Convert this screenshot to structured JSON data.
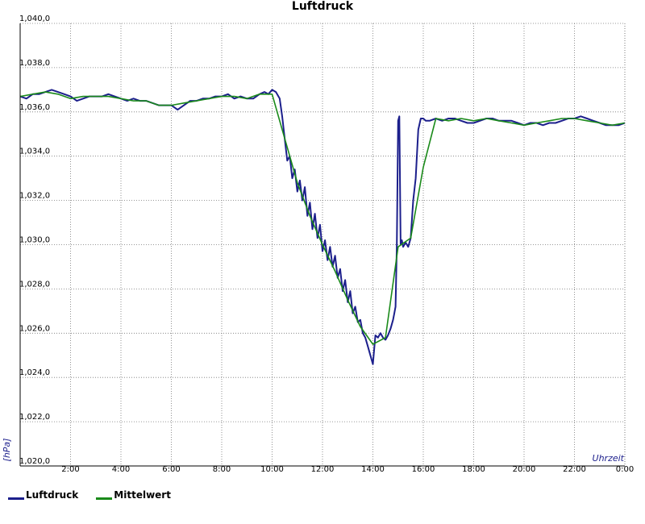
{
  "chart_data": {
    "type": "line",
    "title": "Luftdruck",
    "xlabel": "Uhrzeit",
    "ylabel": "[hPa]",
    "xlim": [
      0,
      24
    ],
    "ylim": [
      1020.0,
      1040.0
    ],
    "grid": true,
    "legend_position": "bottom-left",
    "x_ticks": [
      {
        "value": 2,
        "label": "2:00"
      },
      {
        "value": 4,
        "label": "4:00"
      },
      {
        "value": 6,
        "label": "6:00"
      },
      {
        "value": 8,
        "label": "8:00"
      },
      {
        "value": 10,
        "label": "10:00"
      },
      {
        "value": 12,
        "label": "12:00"
      },
      {
        "value": 14,
        "label": "14:00"
      },
      {
        "value": 16,
        "label": "16:00"
      },
      {
        "value": 18,
        "label": "18:00"
      },
      {
        "value": 20,
        "label": "20:00"
      },
      {
        "value": 22,
        "label": "22:00"
      },
      {
        "value": 24,
        "label": "0:00"
      }
    ],
    "y_ticks": [
      {
        "value": 1020,
        "label": "1,020,0"
      },
      {
        "value": 1022,
        "label": "1,022,0"
      },
      {
        "value": 1024,
        "label": "1,024,0"
      },
      {
        "value": 1026,
        "label": "1,026,0"
      },
      {
        "value": 1028,
        "label": "1,028,0"
      },
      {
        "value": 1030,
        "label": "1,030,0"
      },
      {
        "value": 1032,
        "label": "1,032,0"
      },
      {
        "value": 1034,
        "label": "1,034,0"
      },
      {
        "value": 1036,
        "label": "1,036,0"
      },
      {
        "value": 1038,
        "label": "1,038,0"
      },
      {
        "value": 1040,
        "label": "1,040,0"
      }
    ],
    "series": [
      {
        "name": "Luftdruck",
        "color": "#1c1f8c",
        "x": [
          0,
          0.25,
          0.5,
          0.75,
          1,
          1.25,
          1.5,
          1.75,
          2,
          2.25,
          2.5,
          2.75,
          3,
          3.25,
          3.5,
          3.75,
          4,
          4.25,
          4.5,
          4.75,
          5,
          5.25,
          5.5,
          5.75,
          6,
          6.25,
          6.5,
          6.75,
          7,
          7.25,
          7.5,
          7.75,
          8,
          8.25,
          8.5,
          8.75,
          9,
          9.25,
          9.5,
          9.7,
          9.85,
          10.0,
          10.15,
          10.3,
          10.4,
          10.5,
          10.6,
          10.7,
          10.8,
          10.9,
          11.0,
          11.1,
          11.2,
          11.3,
          11.4,
          11.5,
          11.6,
          11.7,
          11.8,
          11.9,
          12.0,
          12.1,
          12.2,
          12.3,
          12.4,
          12.5,
          12.6,
          12.7,
          12.8,
          12.9,
          13.0,
          13.1,
          13.2,
          13.3,
          13.4,
          13.5,
          13.6,
          13.7,
          13.8,
          13.9,
          14.0,
          14.1,
          14.2,
          14.3,
          14.4,
          14.5,
          14.6,
          14.7,
          14.8,
          14.85,
          14.9,
          14.95,
          15.0,
          15.05,
          15.1,
          15.15,
          15.2,
          15.3,
          15.4,
          15.5,
          15.6,
          15.7,
          15.8,
          15.9,
          16.0,
          16.1,
          16.25,
          16.5,
          16.75,
          17,
          17.25,
          17.5,
          17.75,
          18,
          18.25,
          18.5,
          18.75,
          19,
          19.25,
          19.5,
          19.75,
          20,
          20.25,
          20.5,
          20.75,
          21,
          21.25,
          21.5,
          21.75,
          22,
          22.25,
          22.5,
          22.75,
          23,
          23.25,
          23.5,
          23.75,
          24
        ],
        "y": [
          1036.7,
          1036.6,
          1036.8,
          1036.8,
          1036.9,
          1037.0,
          1036.9,
          1036.8,
          1036.7,
          1036.5,
          1036.6,
          1036.7,
          1036.7,
          1036.7,
          1036.8,
          1036.7,
          1036.6,
          1036.5,
          1036.6,
          1036.5,
          1036.5,
          1036.4,
          1036.3,
          1036.3,
          1036.3,
          1036.1,
          1036.3,
          1036.5,
          1036.5,
          1036.6,
          1036.6,
          1036.7,
          1036.7,
          1036.8,
          1036.6,
          1036.7,
          1036.6,
          1036.6,
          1036.8,
          1036.9,
          1036.8,
          1037.0,
          1036.9,
          1036.6,
          1035.8,
          1034.8,
          1033.8,
          1034.0,
          1033.0,
          1033.4,
          1032.4,
          1032.9,
          1032.0,
          1032.6,
          1031.3,
          1031.9,
          1030.7,
          1031.4,
          1030.3,
          1030.9,
          1029.7,
          1030.2,
          1029.3,
          1029.9,
          1029.0,
          1029.5,
          1028.5,
          1028.9,
          1027.9,
          1028.4,
          1027.4,
          1027.9,
          1026.9,
          1027.2,
          1026.5,
          1026.6,
          1026.0,
          1025.8,
          1025.4,
          1025.0,
          1024.6,
          1025.9,
          1025.8,
          1026.0,
          1025.8,
          1025.7,
          1025.9,
          1026.2,
          1026.6,
          1026.9,
          1027.2,
          1030.0,
          1035.6,
          1035.8,
          1030.0,
          1030.2,
          1029.9,
          1030.1,
          1029.9,
          1030.3,
          1032.0,
          1033.0,
          1035.2,
          1035.7,
          1035.7,
          1035.6,
          1035.6,
          1035.7,
          1035.6,
          1035.7,
          1035.7,
          1035.6,
          1035.5,
          1035.5,
          1035.6,
          1035.7,
          1035.7,
          1035.6,
          1035.6,
          1035.6,
          1035.5,
          1035.4,
          1035.5,
          1035.5,
          1035.4,
          1035.5,
          1035.5,
          1035.6,
          1035.7,
          1035.7,
          1035.8,
          1035.7,
          1035.6,
          1035.5,
          1035.4,
          1035.4,
          1035.4,
          1035.5
        ]
      },
      {
        "name": "Mittelwert",
        "color": "#1a8a1a",
        "x": [
          0,
          0.5,
          1,
          1.5,
          2,
          2.5,
          3,
          3.5,
          4,
          4.5,
          5,
          5.5,
          6,
          6.5,
          7,
          7.5,
          8,
          8.5,
          9,
          9.5,
          10,
          10.5,
          11,
          11.5,
          12,
          12.5,
          13,
          13.5,
          14,
          14.5,
          15,
          15.5,
          16,
          16.5,
          17,
          17.5,
          18,
          18.5,
          19,
          19.5,
          20,
          20.5,
          21,
          21.5,
          22,
          22.5,
          23,
          23.5,
          24
        ],
        "y": [
          1036.7,
          1036.8,
          1036.9,
          1036.8,
          1036.6,
          1036.7,
          1036.7,
          1036.7,
          1036.6,
          1036.5,
          1036.5,
          1036.3,
          1036.3,
          1036.4,
          1036.5,
          1036.6,
          1036.7,
          1036.7,
          1036.6,
          1036.8,
          1036.8,
          1034.8,
          1032.8,
          1031.3,
          1030.0,
          1028.8,
          1027.5,
          1026.3,
          1025.5,
          1025.8,
          1029.9,
          1030.3,
          1033.5,
          1035.7,
          1035.6,
          1035.7,
          1035.6,
          1035.7,
          1035.6,
          1035.5,
          1035.4,
          1035.5,
          1035.6,
          1035.7,
          1035.7,
          1035.6,
          1035.5,
          1035.4,
          1035.5
        ]
      }
    ]
  }
}
